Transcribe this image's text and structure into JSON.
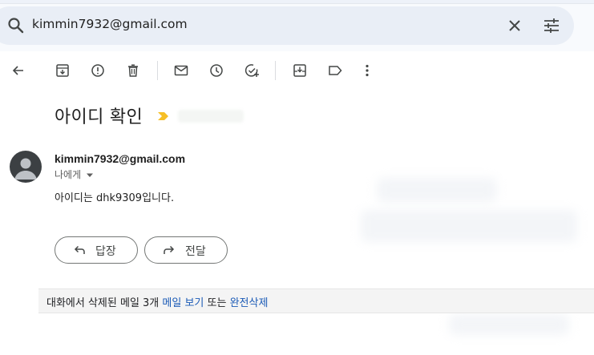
{
  "search": {
    "query": "kimmin7932@gmail.com",
    "icons": {
      "search": "search-icon",
      "clear": "close-icon",
      "options": "tune-icon"
    }
  },
  "toolbar": {
    "icons": [
      "back-arrow-icon",
      "archive-icon",
      "report-spam-icon",
      "delete-icon",
      "mark-unread-icon",
      "snooze-icon",
      "add-task-icon",
      "move-to-icon",
      "label-icon",
      "more-vert-icon"
    ]
  },
  "message": {
    "subject": "아이디 확인",
    "sender_email": "kimmin7932@gmail.com",
    "to_label": "나에게",
    "body": "아이디는 dhk9309입니다."
  },
  "actions": {
    "reply_label": "답장",
    "forward_label": "전달"
  },
  "deleted_notice": {
    "prefix": "대화에서 삭제된 메일 3개 ",
    "view_link": "메일 보기",
    "middle": " 또는 ",
    "delete_link": "완전삭제"
  },
  "colors": {
    "search_bg": "#e9eef6",
    "link": "#1a5ab6",
    "importance_marker": "#f6bf26"
  }
}
